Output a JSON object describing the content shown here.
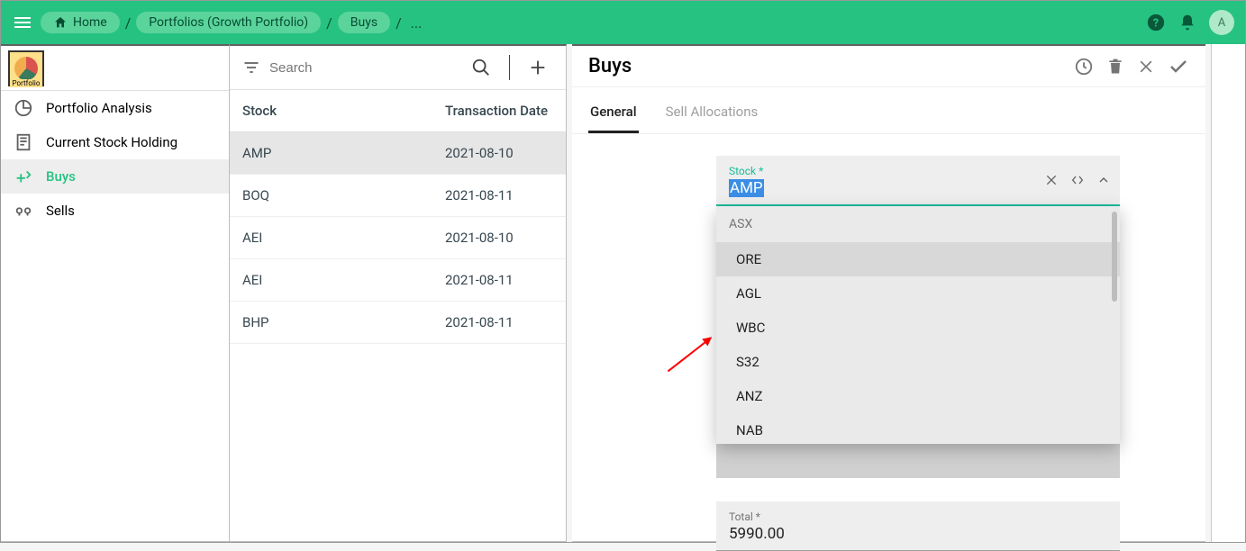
{
  "topbar": {
    "breadcrumb": [
      {
        "label": "Home",
        "icon": "home"
      },
      {
        "label": "Portfolios (Growth Portfolio)"
      },
      {
        "label": "Buys"
      }
    ],
    "avatar_initial": "A"
  },
  "nav": {
    "brand_text": "Portfolio",
    "items": [
      {
        "label": "Portfolio Analysis",
        "icon": "pie"
      },
      {
        "label": "Current Stock Holding",
        "icon": "receipt"
      },
      {
        "label": "Buys",
        "icon": "buy"
      },
      {
        "label": "Sells",
        "icon": "sell"
      }
    ],
    "selected_index": 2
  },
  "list": {
    "search_placeholder": "Search",
    "headers": {
      "stock": "Stock",
      "date": "Transaction Date"
    },
    "rows": [
      {
        "stock": "AMP",
        "date": "2021-08-10"
      },
      {
        "stock": "BOQ",
        "date": "2021-08-11"
      },
      {
        "stock": "AEI",
        "date": "2021-08-10"
      },
      {
        "stock": "AEI",
        "date": "2021-08-11"
      },
      {
        "stock": "BHP",
        "date": "2021-08-11"
      }
    ],
    "selected_index": 0
  },
  "detail": {
    "title": "Buys",
    "tabs": [
      {
        "label": "General",
        "active": true
      },
      {
        "label": "Sell Allocations",
        "active": false
      }
    ],
    "stock_field": {
      "label": "Stock *",
      "value": "AMP",
      "dropdown": {
        "group": "ASX",
        "options": [
          "ORE",
          "AGL",
          "WBC",
          "S32",
          "ANZ",
          "NAB"
        ]
      }
    },
    "total_field": {
      "label": "Total *",
      "value": "5990.00"
    }
  }
}
